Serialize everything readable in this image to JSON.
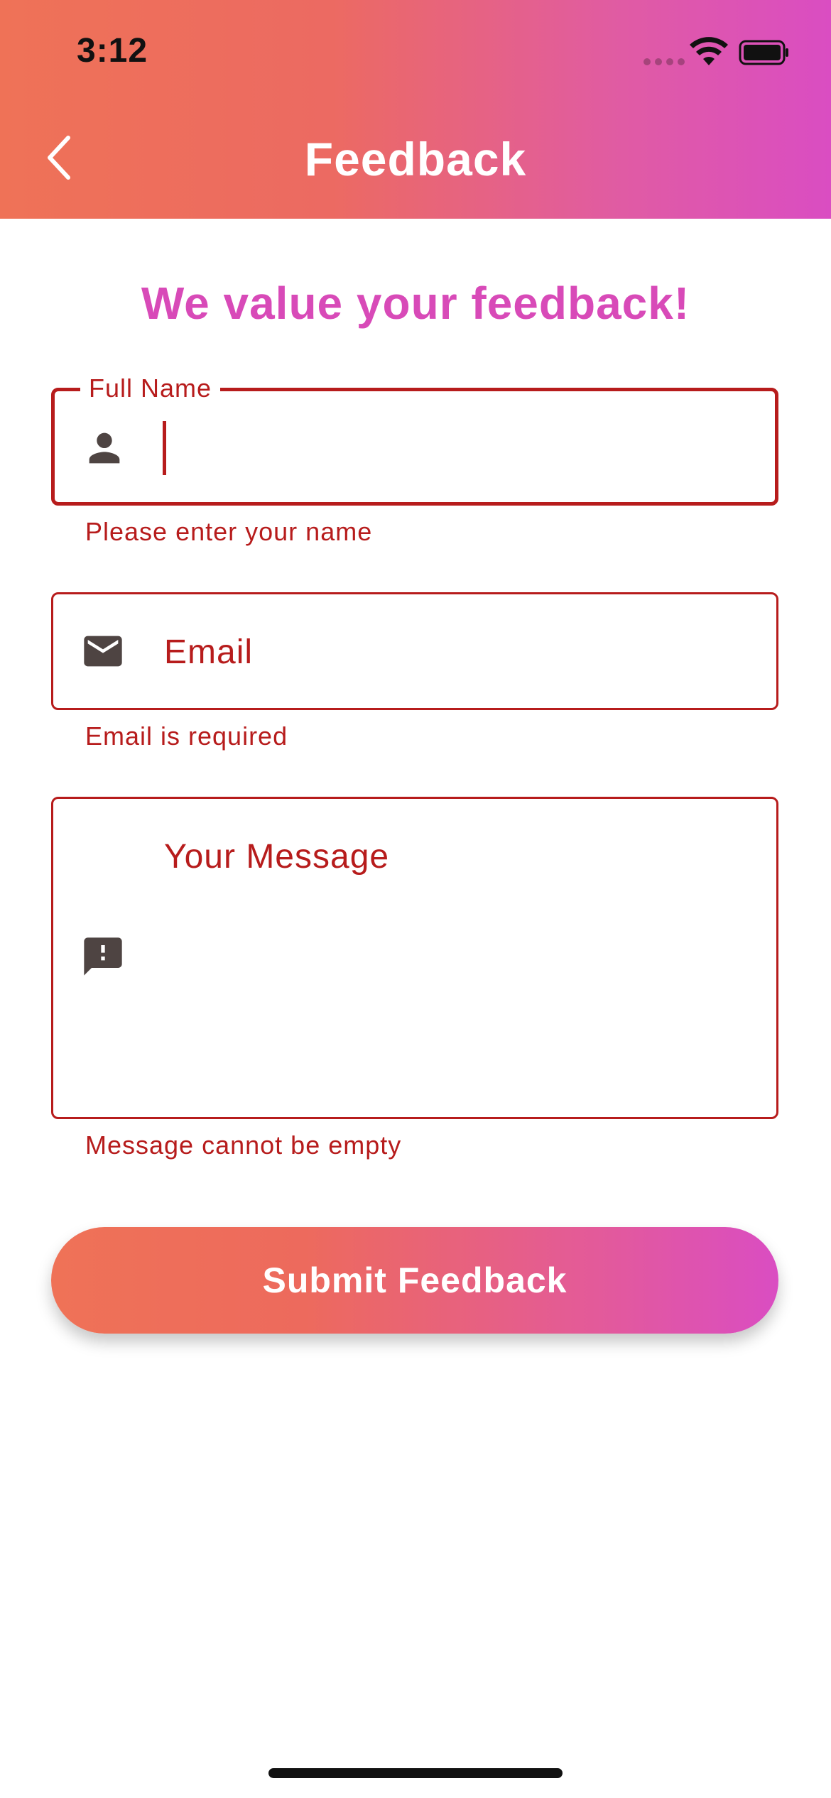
{
  "status_bar": {
    "time": "3:12"
  },
  "app_bar": {
    "title": "Feedback",
    "back_icon": "chevron-left-icon"
  },
  "form": {
    "headline": "We value your feedback!",
    "name_field": {
      "label": "Full Name",
      "value": "",
      "icon": "person-icon",
      "error": "Please enter your name"
    },
    "email_field": {
      "placeholder": "Email",
      "value": "",
      "icon": "mail-icon",
      "error": "Email is required"
    },
    "message_field": {
      "placeholder": "Your Message",
      "value": "",
      "icon": "feedback-icon",
      "error": "Message cannot be empty"
    },
    "submit_label": "Submit Feedback"
  },
  "colors": {
    "gradient_start": "#ef7257",
    "gradient_end": "#da4dc2",
    "error": "#b71c1c",
    "headline": "#d84ab8",
    "icon": "#4e4442"
  }
}
